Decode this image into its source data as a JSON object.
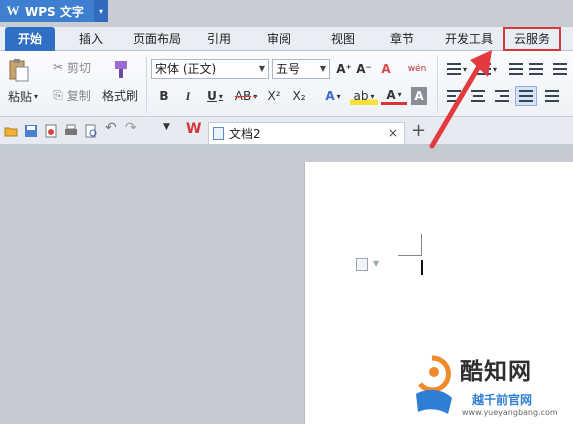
{
  "app": {
    "title": "WPS 文字",
    "logo_letter": "W",
    "dropdown_glyph": "▾"
  },
  "tabs": [
    {
      "label": "开始",
      "active": true
    },
    {
      "label": "插入"
    },
    {
      "label": "页面布局"
    },
    {
      "label": "引用"
    },
    {
      "label": "审阅"
    },
    {
      "label": "视图"
    },
    {
      "label": "章节"
    },
    {
      "label": "开发工具"
    },
    {
      "label": "云服务",
      "highlighted": true
    }
  ],
  "ribbon": {
    "paste": "粘贴",
    "cut": "剪切",
    "copy": "复制",
    "format_painter": "格式刷",
    "font_name": "宋体 (正文)",
    "font_size": "五号",
    "grow_font": "A⁺",
    "shrink_font": "A⁻",
    "clear_format": "A",
    "phonetic": "wén",
    "bold": "B",
    "italic": "I",
    "underline": "U",
    "strike": "AB",
    "superscript": "X²",
    "subscript": "X₂",
    "text_effect": "A",
    "highlight": "ab",
    "font_color": "A",
    "char_shading": "A"
  },
  "document": {
    "tab_name": "文档2",
    "close": "×",
    "new_tab": "+"
  },
  "watermark": {
    "title": "酷知网",
    "subtitle": "越千前官网",
    "url": "www.yueyangbang.com"
  },
  "colors": {
    "accent": "#2f6fc4",
    "highlight_box": "#d7383c",
    "arrow": "#e23a3e"
  }
}
